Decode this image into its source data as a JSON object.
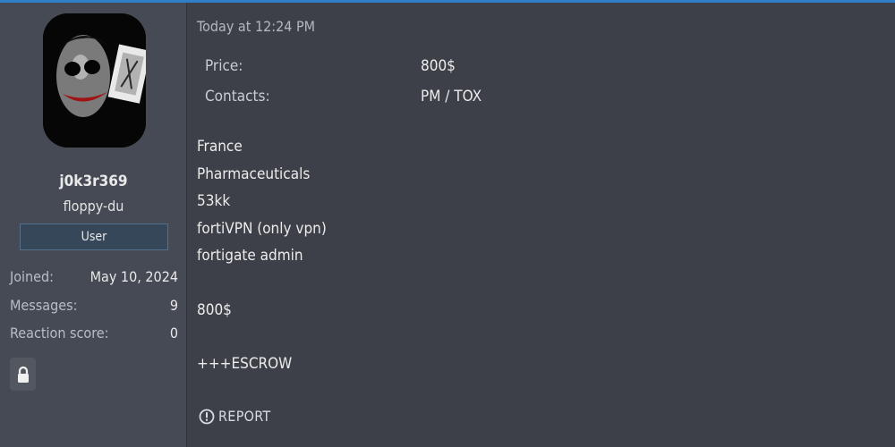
{
  "user": {
    "username": "j0k3r369",
    "title": "floppy-du",
    "banner": "User",
    "stats": [
      {
        "label": "Joined:",
        "value": "May 10, 2024"
      },
      {
        "label": "Messages:",
        "value": "9"
      },
      {
        "label": "Reaction score:",
        "value": "0"
      }
    ],
    "avatar_icon": "joker-card-avatar",
    "lock_icon": "lock-icon"
  },
  "post": {
    "timestamp": "Today at 12:24 PM",
    "fields": [
      {
        "label": "Price:",
        "value": "800$"
      },
      {
        "label": "Contacts:",
        "value": "PM / TOX"
      }
    ],
    "body_lines": [
      "France",
      "Pharmaceuticals",
      "53kk",
      "fortiVPN (only vpn)",
      "fortigate admin",
      "800$",
      "+++ESCROW"
    ],
    "report_label": "REPORT"
  },
  "colors": {
    "accent": "#2f7fc8",
    "background": "#3d4048",
    "sidebar": "#454a54",
    "banner": "#364759"
  }
}
